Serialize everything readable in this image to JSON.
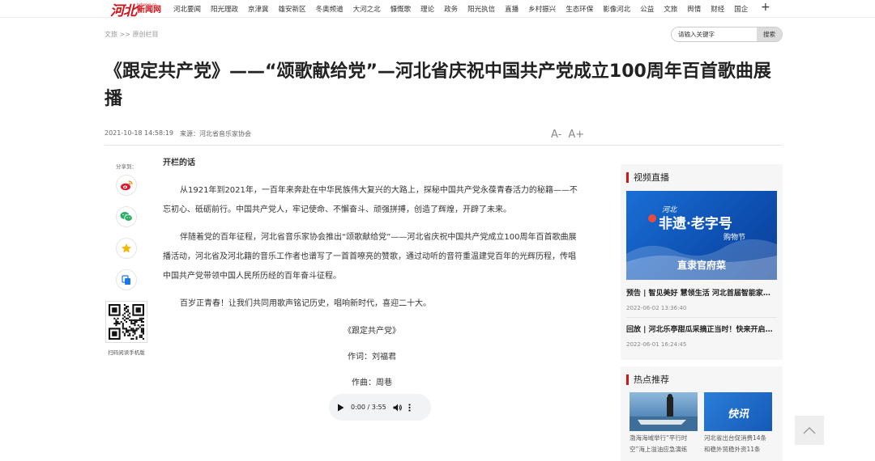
{
  "header": {
    "logo_mark": "河北",
    "logo_site": "hebnews.cn",
    "logo_name": "新闻网",
    "nav": [
      "河北要闻",
      "阳光理政",
      "京津冀",
      "雄安新区",
      "冬奥频道",
      "大河之北",
      "慷慨歌",
      "理论",
      "政务",
      "阳光执信",
      "直播",
      "乡村振兴",
      "生态环保",
      "影像河北",
      "公益",
      "文旅",
      "舆情",
      "财经",
      "国企"
    ]
  },
  "breadcrumb": "文旅 >> 原创栏目",
  "search": {
    "placeholder": "请输入关键字",
    "button": "搜索"
  },
  "article": {
    "title": "《跟定共产党》——“颂歌献给党”—河北省庆祝中国共产党成立100周年百首歌曲展播",
    "datetime": "2021-10-18 14:58:19",
    "source": "来源：河北省音乐家协会",
    "font_smaller": "A-",
    "font_larger": "A+",
    "lead": "开栏的话",
    "paragraphs": [
      "从1921年到2021年，一百年来奔赴在中华民族伟大复兴的大路上，探秘中国共产党永葆青春活力的秘籍——不忘初心、砥砺前行。中国共产党人，牢记使命、不懈奋斗、顽强拼搏，创造了辉煌，开辟了未来。",
      "伴随着党的百年征程，河北省音乐家协会推出“颂歌献给党”——河北省庆祝中国共产党成立100周年百首歌曲展播活动，河北省及河北籍的音乐工作者也谱写了一首首嘹亮的赞歌，通过动听的音符重温建党百年的光辉历程，传唱中国共产党带领中国人民所历经的百年奋斗征程。",
      "百岁正青春！让我们共同用歌声铭记历史，唱响新时代，喜迎二十大。"
    ],
    "song_title": "《跟定共产党》",
    "lyricist": "作词：刘福君",
    "composer": "作曲：周巷",
    "audio_time": "0:00 / 3:55"
  },
  "share": {
    "label": "分享到：",
    "qr_label": "扫码阅读手机版"
  },
  "sidebar": {
    "video_head": "视频直播",
    "video_banner": {
      "line1": "河北",
      "line2": "非遗·老字号",
      "line3": "购物节",
      "footer": "直隶官府菜"
    },
    "video_news": [
      {
        "title": "预告 | 智见美好 慧领生活 河北首届智能家居消费节",
        "date": "2022-06-02 13:36:40"
      },
      {
        "title": "回放 | 河北乐亭甜瓜采摘正当时！快来开启甜蜜之旅",
        "date": "2022-06-01 16:24:45"
      }
    ],
    "hot_head": "热点推荐",
    "hot_items": [
      {
        "caption": "渤海海域举行“平行时空”海上溢油应急演练"
      },
      {
        "caption": "河北省出台促消费14条和稳外贸稳外资11条",
        "badge": "快讯"
      }
    ]
  },
  "colors": {
    "brand": "#d0141b",
    "banner": "#1a6fd6"
  }
}
